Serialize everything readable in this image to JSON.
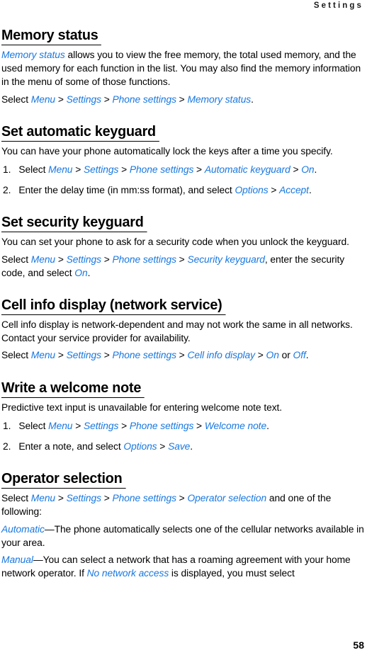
{
  "header": {
    "running_title": "Settings"
  },
  "footer": {
    "page_number": "58"
  },
  "colors": {
    "link": "#1978e0",
    "text": "#000000",
    "background": "#ffffff"
  },
  "sections": [
    {
      "id": "memory-status",
      "heading": "Memory status",
      "paragraphs": [
        {
          "id": "memory-status-p1",
          "runs": [
            {
              "t": "Memory status",
              "s": "link"
            },
            {
              "t": " allows you to view the free memory, the total used memory, and the used memory for each function in the list. You may also find the memory information in the menu of some of those functions.",
              "s": "plain"
            }
          ]
        },
        {
          "id": "memory-status-p2",
          "runs": [
            {
              "t": "Select ",
              "s": "plain"
            },
            {
              "t": "Menu",
              "s": "link"
            },
            {
              "t": " > ",
              "s": "plain"
            },
            {
              "t": "Settings",
              "s": "link"
            },
            {
              "t": " > ",
              "s": "plain"
            },
            {
              "t": "Phone settings",
              "s": "link"
            },
            {
              "t": " > ",
              "s": "plain"
            },
            {
              "t": "Memory status",
              "s": "link"
            },
            {
              "t": ".",
              "s": "plain"
            }
          ]
        }
      ],
      "list": []
    },
    {
      "id": "set-automatic-keyguard",
      "heading": "Set automatic keyguard",
      "paragraphs": [
        {
          "id": "auto-keyguard-p1",
          "runs": [
            {
              "t": "You can have your phone automatically lock the keys after a time you specify.",
              "s": "plain"
            }
          ]
        }
      ],
      "list": [
        {
          "num": "1.",
          "runs": [
            {
              "t": "Select ",
              "s": "plain"
            },
            {
              "t": "Menu",
              "s": "link"
            },
            {
              "t": " > ",
              "s": "plain"
            },
            {
              "t": "Settings",
              "s": "link"
            },
            {
              "t": " > ",
              "s": "plain"
            },
            {
              "t": "Phone settings",
              "s": "link"
            },
            {
              "t": " > ",
              "s": "plain"
            },
            {
              "t": "Automatic keyguard",
              "s": "link"
            },
            {
              "t": " > ",
              "s": "plain"
            },
            {
              "t": "On",
              "s": "link"
            },
            {
              "t": ".",
              "s": "plain"
            }
          ]
        },
        {
          "num": "2.",
          "runs": [
            {
              "t": "Enter the delay time (in mm:ss format), and select ",
              "s": "plain"
            },
            {
              "t": "Options",
              "s": "link"
            },
            {
              "t": " > ",
              "s": "plain"
            },
            {
              "t": "Accept",
              "s": "link"
            },
            {
              "t": ".",
              "s": "plain"
            }
          ]
        }
      ]
    },
    {
      "id": "set-security-keyguard",
      "heading": "Set security keyguard",
      "paragraphs": [
        {
          "id": "sec-keyguard-p1",
          "runs": [
            {
              "t": "You can set your phone to ask for a security code when you unlock the keyguard.",
              "s": "plain"
            }
          ]
        },
        {
          "id": "sec-keyguard-p2",
          "runs": [
            {
              "t": "Select ",
              "s": "plain"
            },
            {
              "t": "Menu",
              "s": "link"
            },
            {
              "t": " > ",
              "s": "plain"
            },
            {
              "t": "Settings",
              "s": "link"
            },
            {
              "t": " > ",
              "s": "plain"
            },
            {
              "t": "Phone settings",
              "s": "link"
            },
            {
              "t": " > ",
              "s": "plain"
            },
            {
              "t": "Security keyguard",
              "s": "link"
            },
            {
              "t": ", enter the security code, and select ",
              "s": "plain"
            },
            {
              "t": "On",
              "s": "link"
            },
            {
              "t": ".",
              "s": "plain"
            }
          ]
        }
      ],
      "list": []
    },
    {
      "id": "cell-info-display",
      "heading": "Cell info display (network service)",
      "paragraphs": [
        {
          "id": "cell-info-p1",
          "runs": [
            {
              "t": "Cell info display is network-dependent and may not work the same in all networks. Contact your service provider for availability.",
              "s": "plain"
            }
          ]
        },
        {
          "id": "cell-info-p2",
          "runs": [
            {
              "t": "Select ",
              "s": "plain"
            },
            {
              "t": "Menu",
              "s": "link"
            },
            {
              "t": " > ",
              "s": "plain"
            },
            {
              "t": "Settings",
              "s": "link"
            },
            {
              "t": " > ",
              "s": "plain"
            },
            {
              "t": "Phone settings",
              "s": "link"
            },
            {
              "t": " > ",
              "s": "plain"
            },
            {
              "t": "Cell info display",
              "s": "link"
            },
            {
              "t": " > ",
              "s": "plain"
            },
            {
              "t": "On",
              "s": "link"
            },
            {
              "t": " or ",
              "s": "plain"
            },
            {
              "t": "Off",
              "s": "link"
            },
            {
              "t": ".",
              "s": "plain"
            }
          ]
        }
      ],
      "list": []
    },
    {
      "id": "write-a-welcome-note",
      "heading": "Write a welcome note",
      "paragraphs": [
        {
          "id": "welcome-note-p1",
          "runs": [
            {
              "t": "Predictive text input is unavailable for entering welcome note text.",
              "s": "plain"
            }
          ]
        }
      ],
      "list": [
        {
          "num": "1.",
          "runs": [
            {
              "t": "Select ",
              "s": "plain"
            },
            {
              "t": "Menu",
              "s": "link"
            },
            {
              "t": " > ",
              "s": "plain"
            },
            {
              "t": "Settings",
              "s": "link"
            },
            {
              "t": " > ",
              "s": "plain"
            },
            {
              "t": "Phone settings",
              "s": "link"
            },
            {
              "t": " > ",
              "s": "plain"
            },
            {
              "t": "Welcome note",
              "s": "link"
            },
            {
              "t": ".",
              "s": "plain"
            }
          ]
        },
        {
          "num": "2.",
          "runs": [
            {
              "t": "Enter a note, and select ",
              "s": "plain"
            },
            {
              "t": "Options",
              "s": "link"
            },
            {
              "t": " > ",
              "s": "plain"
            },
            {
              "t": "Save",
              "s": "link"
            },
            {
              "t": ".",
              "s": "plain"
            }
          ]
        }
      ]
    },
    {
      "id": "operator-selection",
      "heading": "Operator selection",
      "paragraphs": [
        {
          "id": "operator-p1",
          "runs": [
            {
              "t": "Select ",
              "s": "plain"
            },
            {
              "t": "Menu",
              "s": "link"
            },
            {
              "t": " > ",
              "s": "plain"
            },
            {
              "t": "Settings",
              "s": "link"
            },
            {
              "t": " > ",
              "s": "plain"
            },
            {
              "t": "Phone settings",
              "s": "link"
            },
            {
              "t": " > ",
              "s": "plain"
            },
            {
              "t": "Operator selection",
              "s": "link"
            },
            {
              "t": " and one of the following:",
              "s": "plain"
            }
          ]
        },
        {
          "id": "operator-p2",
          "runs": [
            {
              "t": "Automatic",
              "s": "link"
            },
            {
              "t": "—The phone automatically selects one of the cellular networks available in your area.",
              "s": "plain"
            }
          ]
        },
        {
          "id": "operator-p3",
          "runs": [
            {
              "t": "Manual",
              "s": "link"
            },
            {
              "t": "—You can select a network that has a roaming agreement with your home network operator. If ",
              "s": "plain"
            },
            {
              "t": "No network access",
              "s": "link"
            },
            {
              "t": " is displayed, you must select",
              "s": "plain"
            }
          ]
        }
      ],
      "list": []
    }
  ]
}
